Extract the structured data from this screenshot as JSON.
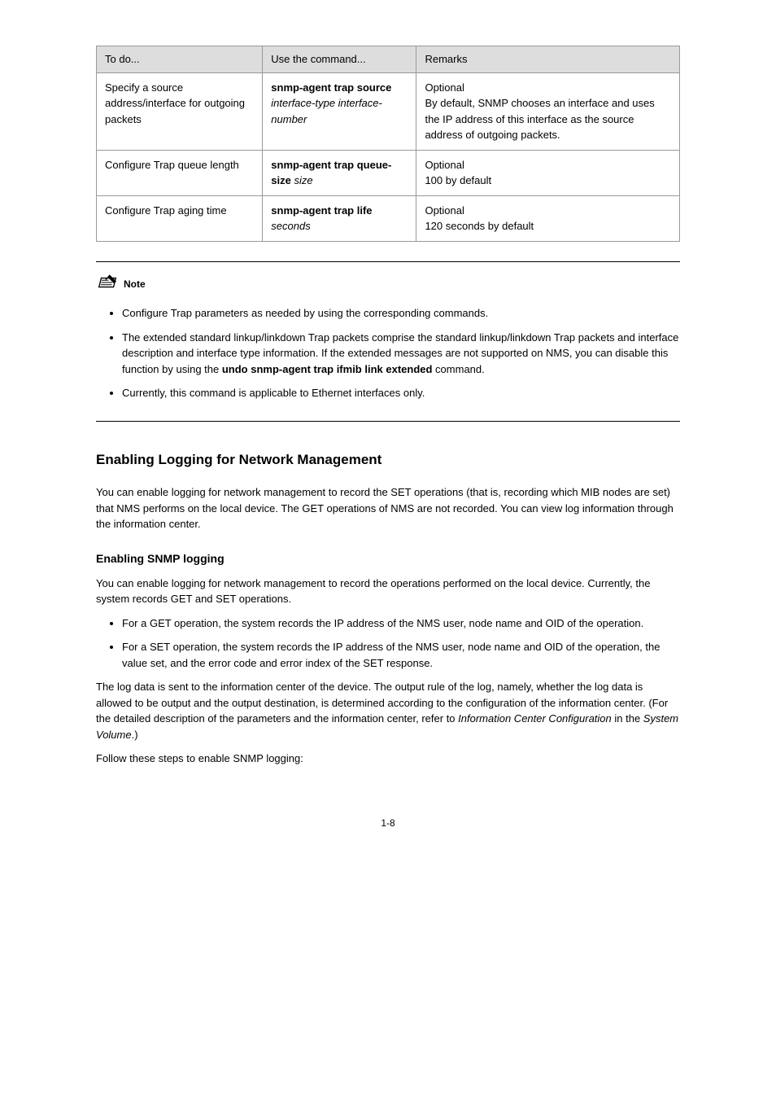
{
  "table": {
    "headers": [
      "To do...",
      "Use the command...",
      "Remarks"
    ],
    "rows": [
      {
        "c0": "Specify a source address/interface for outgoing packets",
        "c1_pre": "snmp-agent trap source",
        "c1_it": "interface-type interface-number",
        "c2": "Optional\nBy default, SNMP chooses an interface and uses the IP address of this interface as the source address of outgoing packets."
      },
      {
        "c0": "Configure Trap queue length",
        "c1_pre": "snmp-agent trap queue-size ",
        "c1_it": "size",
        "c2": "Optional\n100 by default"
      },
      {
        "c0": "Configure Trap aging time",
        "c1_pre": "snmp-agent trap life ",
        "c1_it": "seconds",
        "c2": "Optional\n120 seconds by default"
      }
    ]
  },
  "note": {
    "label": "Note",
    "items": [
      "Configure Trap parameters as needed by using the corresponding commands.",
      {
        "pre": "The extended standard linkup/linkdown Trap packets comprise the standard linkup/linkdown Trap packets and interface description and interface type information. If the extended messages are not supported on NMS, you can disable this function by using the ",
        "bold": "undo snmp-agent trap ifmib link extended",
        "post": " command."
      },
      "Currently, this command is applicable to Ethernet interfaces only."
    ]
  },
  "logging_title": "Enabling Logging for Network Management",
  "logging_intro": "You can enable logging for network management to record the SET operations (that is, recording which MIB nodes are set) that NMS performs on the local device. The GET operations of NMS are not recorded. You can view log information through the information center.",
  "logging_sub": "Enabling SNMP logging",
  "logging_para1": "You can enable logging for network management to record the operations performed on the local device. Currently, the system records GET and SET operations.",
  "logging_bullets": [
    "For a GET operation, the system records the IP address of the NMS user, node name and OID of the operation.",
    "For a SET operation, the system records the IP address of the NMS user, node name and OID of the operation, the value set, and the error code and error index of the SET response."
  ],
  "logging_para2_pre": "The log data is sent to the information center of the device. The output rule of the log, namely, whether the log data is allowed to be output and the output destination, is determined according to the configuration of the information center. (For the detailed description of the parameters and the information center, refer to ",
  "logging_para2_it": "Information Center Configuration",
  "logging_para2_post": " in the ",
  "logging_para2_it2": "System Volume",
  "logging_para2_end": ".)",
  "tablecap": "Follow these steps to enable SNMP logging:",
  "page_number": "1-8"
}
